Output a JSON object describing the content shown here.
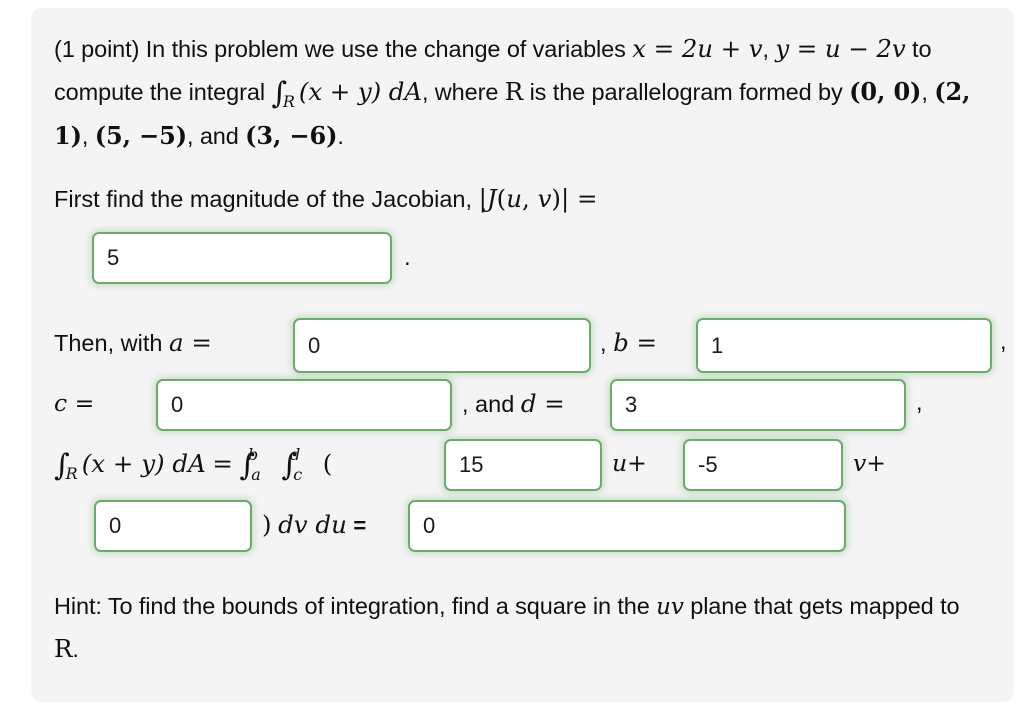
{
  "card": {
    "intro": {
      "point_label": "(1 point)",
      "text_1": "In this problem we use the change of variables",
      "math_x": "x = 2u + v",
      "comma_1": ",",
      "math_y": "y = u − 2v",
      "text_2": "to compute the integral",
      "math_integral": "∫R(x + y) dA",
      "text_3": ", where",
      "math_R": "R",
      "text_4": "is the parallelogram formed by",
      "pt_1": "(0, 0)",
      "pt_2": "(2, 1)",
      "pt_3": "(5, −5)",
      "text_and": "and",
      "pt_4": "(3, −6)",
      "period": "."
    },
    "jacobian": {
      "prompt": "First find the magnitude of the Jacobian,",
      "math_label": "|J(u, v)| =",
      "value": "5",
      "placeholder": "",
      "trailing_period": "."
    },
    "bounds": {
      "then_with": "Then, with",
      "a_label": "a =",
      "a_value": "0",
      "comma_after_a": ",",
      "b_label": "b =",
      "b_value": "1",
      "comma_after_b": ",",
      "c_label": "c =",
      "c_value": "0",
      "and_label": ", and",
      "d_label": "d =",
      "d_value": "3",
      "comma_after_d": ","
    },
    "integral_line": {
      "lhs": "∫R(x + y) dA =",
      "outer_integral_lower": "a",
      "outer_integral_upper": "b",
      "inner_integral_lower": "c",
      "inner_integral_upper": "d",
      "open_paren": "(",
      "coef_u_value": "15",
      "u_plus": "u+",
      "coef_v_value": "-5",
      "v_plus": "v+",
      "const_value": "0",
      "close_paren": ")",
      "differential": "dv du",
      "equals": "=",
      "result_value": "0"
    },
    "hint": {
      "prefix": "Hint: To find the bounds of integration, find a square in the",
      "math_uv": "uv",
      "suffix": "plane that gets mapped to",
      "math_R": "R",
      "period": "."
    },
    "colors": {
      "card_background": "#f4f4f4",
      "page_background": "#ffffff",
      "input_border": "#6cab6c",
      "input_glow": "rgba(110,175,110,0.33)",
      "text": "#111111"
    }
  }
}
